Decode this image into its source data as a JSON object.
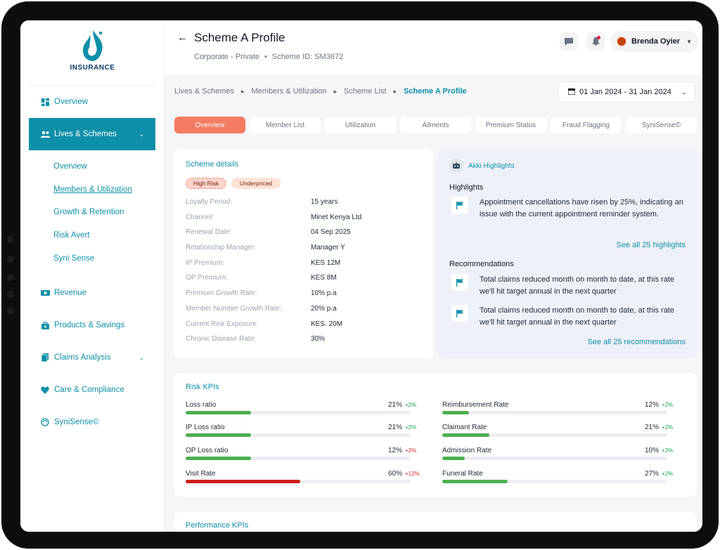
{
  "brand": {
    "logo_text": "INSURANCE",
    "accent": "#0e8fa8",
    "tab_active": "#f47c63"
  },
  "sidebar": {
    "items": [
      {
        "label": "Overview",
        "icon": "dashboard-icon"
      },
      {
        "label": "Lives & Schemes",
        "icon": "people-icon"
      },
      {
        "label": "Revenue",
        "icon": "money-icon"
      },
      {
        "label": "Products & Savings",
        "icon": "bag-icon"
      },
      {
        "label": "Claims Analysis",
        "icon": "document-icon"
      },
      {
        "label": "Care & Compliance",
        "icon": "heart-icon"
      },
      {
        "label": "SyniSense©",
        "icon": "synisense-icon"
      }
    ],
    "subitems": [
      "Overview",
      "Members & Utilization",
      "Growth & Retention",
      "Risk Avert",
      "Syni Sense"
    ]
  },
  "header": {
    "title": "Scheme A Profile",
    "type": "Corporate - Private",
    "separator": "•",
    "scheme_id": "Scheme ID: SM3672",
    "user_name": "Brenda Oyier"
  },
  "breadcrumb": [
    "Lives & Schemes",
    "Members & Utilization",
    "Scheme List",
    "Scheme A Profile"
  ],
  "date_range": "01 Jan 2024 - 31 Jan 2024",
  "tabs": [
    "Overview",
    "Member List",
    "Utilization",
    "Ailments",
    "Premium Status",
    "Fraud Flagging",
    "SyniSense©"
  ],
  "scheme": {
    "title": "Scheme details",
    "badges": [
      "High Risk",
      "Underpriced"
    ],
    "rows": [
      {
        "label": "Loyalty Period:",
        "value": "15 years"
      },
      {
        "label": "Channel:",
        "value": "Minet Kenya Ltd"
      },
      {
        "label": "Renewal Date:",
        "value": "04 Sep 2025"
      },
      {
        "label": "Relationship Manager:",
        "value": "Manager Y"
      },
      {
        "label": "IP Premium:",
        "value": "KES 12M"
      },
      {
        "label": "OP Premium:",
        "value": "KES 8M"
      },
      {
        "label": "Premium Growth Rate:",
        "value": "10% p.a"
      },
      {
        "label": "Member Number Growth Rate:",
        "value": "20% p.a"
      },
      {
        "label": "Current Risk Exposure:",
        "value": "KES. 20M"
      },
      {
        "label": "Chronic Disease Rate:",
        "value": "30%"
      }
    ]
  },
  "akki": {
    "title": "Akki Highlights",
    "highlights_label": "Highlights",
    "highlights": [
      "Appointment cancellations have risen by 25%, indicating an issue with the current appointment reminder system."
    ],
    "see_highlights": "See all 25 highlights",
    "recommendations_label": "Recommendations",
    "recommendations": [
      "Total claims reduced month on month to date, at this rate we'll hit target annual  in the next quarter",
      "Total claims reduced month on month to date, at this rate we'll hit target annual  in the next quarter"
    ],
    "see_recommendations": "See all 25 recommendations"
  },
  "risk_kpis": {
    "title": "Risk KPIs",
    "items": [
      {
        "label": "Loss ratio",
        "value": "21%",
        "delta": "+2%",
        "fill": 0.29,
        "trend": "up"
      },
      {
        "label": "IP Loss ratio",
        "value": "21%",
        "delta": "+2%",
        "fill": 0.29,
        "trend": "up"
      },
      {
        "label": "OP Loss ratio",
        "value": "12%",
        "delta": "+2%",
        "fill": 0.29,
        "trend": "down"
      },
      {
        "label": "Visit Rate",
        "value": "60%",
        "delta": "+12%",
        "fill": 0.51,
        "trend": "down"
      },
      {
        "label": "Reimbursement Rate",
        "value": "12%",
        "delta": "+2%",
        "fill": 0.12,
        "trend": "up"
      },
      {
        "label": "Claimant Rate",
        "value": "21%",
        "delta": "+2%",
        "fill": 0.21,
        "trend": "up"
      },
      {
        "label": "Admission Rate",
        "value": "10%",
        "delta": "+2%",
        "fill": 0.1,
        "trend": "up"
      },
      {
        "label": "Funeral Rate",
        "value": "27%",
        "delta": "+2%",
        "fill": 0.29,
        "trend": "up"
      }
    ]
  },
  "performance_kpis": {
    "title": "Performance KPIs"
  }
}
